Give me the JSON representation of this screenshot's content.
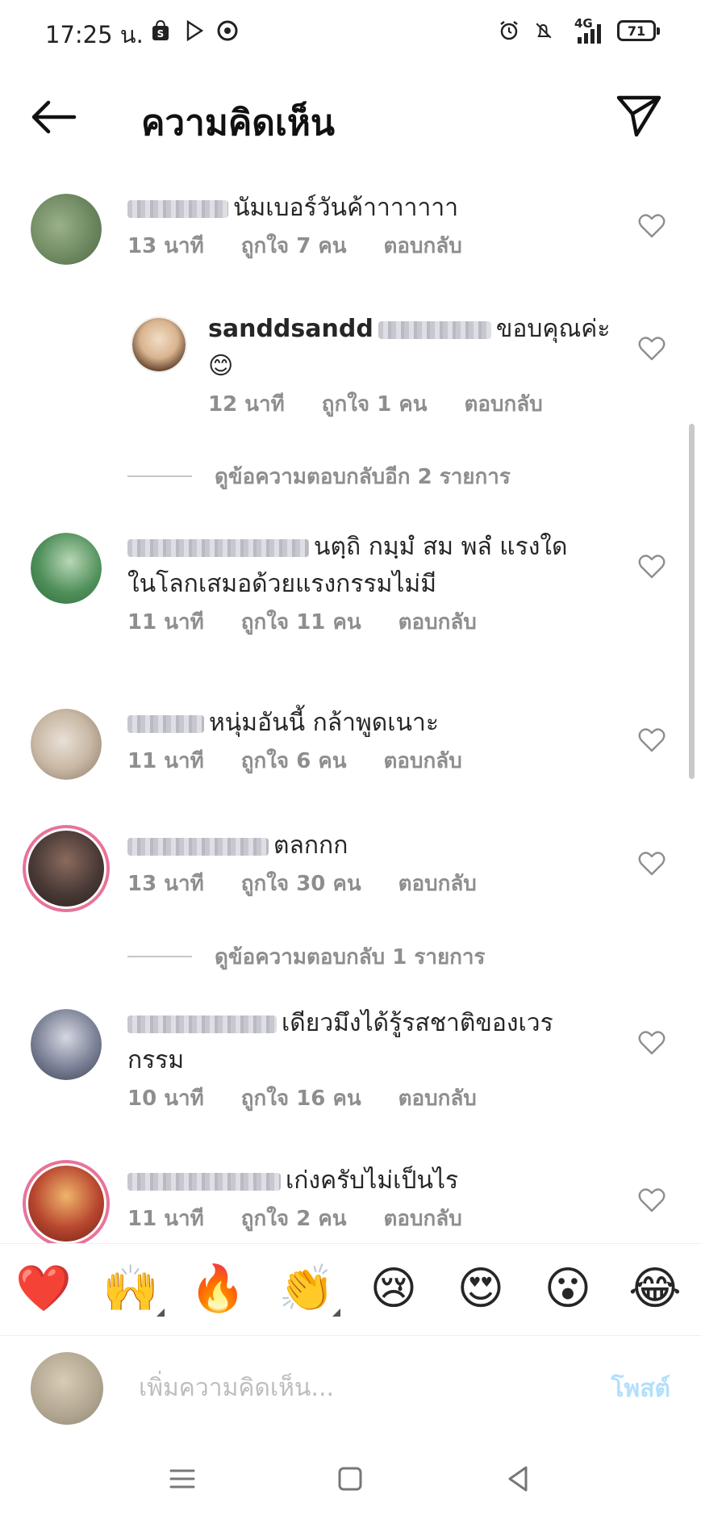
{
  "status_bar": {
    "time": "17:25 น.",
    "network": "4G",
    "battery": "71"
  },
  "header": {
    "title": "ความคิดเห็น"
  },
  "comments": [
    {
      "text": "นัมเบอร์วันค้าาาาาาา",
      "time": "13 นาที",
      "likes": "ถูกใจ 7 คน",
      "reply": "ตอบกลับ",
      "avatar_color": "#6f8a62"
    },
    {
      "username": "sanddsandd",
      "text": "ขอบคุณค่ะ 😊",
      "time": "12 นาที",
      "likes": "ถูกใจ 1 คน",
      "reply": "ตอบกลับ",
      "avatar_color": "#d9b48f"
    },
    {
      "text": "นตฺถิ กมฺมํ สม พลํ แรงใดในโลกเสมอด้วยแรงกรรมไม่มี",
      "time": "11 นาที",
      "likes": "ถูกใจ 11 คน",
      "reply": "ตอบกลับ",
      "avatar_color": "#4f8f5a"
    },
    {
      "text": "หนุ่มอันนี้ กล้าพูดเนาะ",
      "time": "11 นาที",
      "likes": "ถูกใจ 6 คน",
      "reply": "ตอบกลับ",
      "avatar_color": "#c9b9a6"
    },
    {
      "text": "ตลกกก",
      "time": "13 นาที",
      "likes": "ถูกใจ 30 คน",
      "reply": "ตอบกลับ",
      "avatar_color": "#4a3a36"
    },
    {
      "text": "เดียวมึงได้รู้รสชาติของเวรกรรม",
      "time": "10 นาที",
      "likes": "ถูกใจ 16 คน",
      "reply": "ตอบกลับ",
      "avatar_color": "#7b8196"
    },
    {
      "text": "เก่งครับไม่เป็นไร",
      "time": "11 นาที",
      "likes": "ถูกใจ 2 คน",
      "reply": "ตอบกลับ",
      "avatar_color": "#b8462f"
    }
  ],
  "view_replies": [
    "ดูข้อความตอบกลับอีก 2 รายการ",
    "ดูข้อความตอบกลับ 1 รายการ"
  ],
  "emojis": [
    "❤️",
    "🙌",
    "🔥",
    "👏",
    "😢",
    "😍",
    "😮",
    "😂"
  ],
  "input": {
    "placeholder": "เพิ่มความคิดเห็น...",
    "post_label": "โพสต์"
  },
  "colors": {
    "meta_gray": "#8e8e8e",
    "post_blue": "#b2dffc",
    "story_ring": "#e8739a"
  }
}
